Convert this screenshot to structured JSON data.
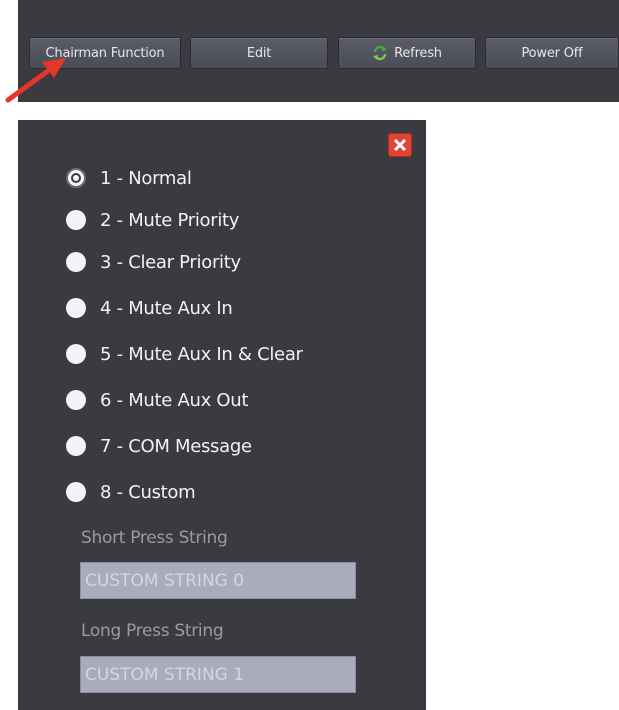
{
  "toolbar": {
    "chairman_label": "Chairman Function",
    "edit_label": "Edit",
    "refresh_label": "Refresh",
    "power_label": "Power Off"
  },
  "dialog": {
    "options": [
      {
        "label": "1 - Normal",
        "selected": true
      },
      {
        "label": "2 - Mute Priority",
        "selected": false
      },
      {
        "label": "3 - Clear Priority",
        "selected": false
      },
      {
        "label": "4 - Mute Aux In",
        "selected": false
      },
      {
        "label": "5 - Mute Aux In & Clear",
        "selected": false
      },
      {
        "label": "6 - Mute Aux Out",
        "selected": false
      },
      {
        "label": "7 - COM Message",
        "selected": false
      },
      {
        "label": "8 - Custom",
        "selected": false
      }
    ],
    "short_press": {
      "label": "Short Press String",
      "value": "CUSTOM STRING 0"
    },
    "long_press": {
      "label": "Long Press String",
      "value": "CUSTOM STRING 1"
    }
  },
  "colors": {
    "panel_bg": "#3a3a40",
    "close_red": "#e0433a",
    "arrow_red": "#e8352a"
  },
  "icons": {
    "refresh": "refresh-icon",
    "close": "close-icon",
    "annotation": "arrow-pointer-icon"
  }
}
